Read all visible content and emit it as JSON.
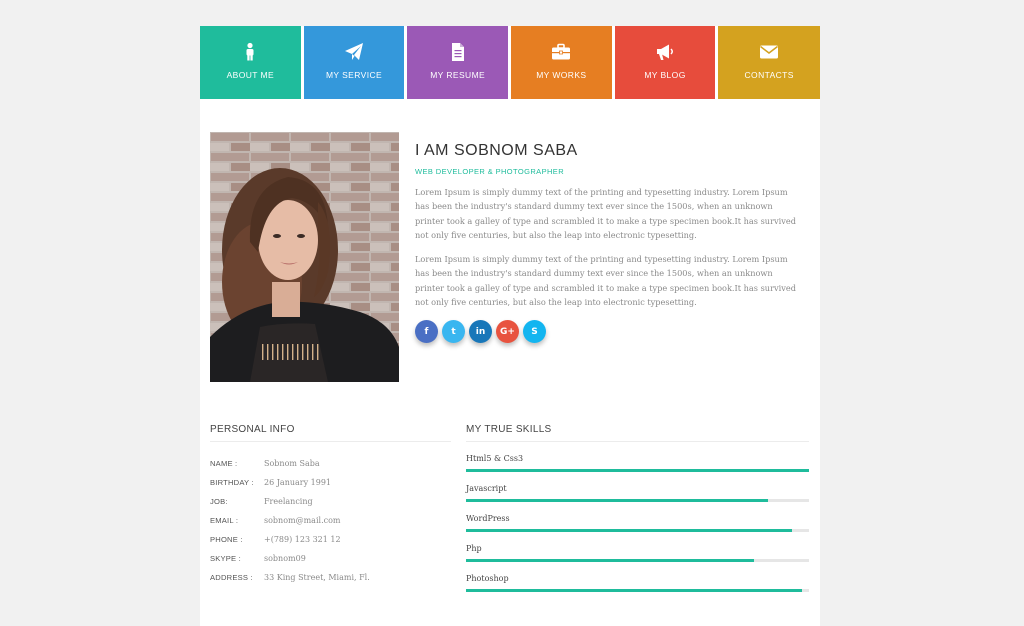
{
  "nav": [
    {
      "label": "ABOUT ME",
      "icon": "person-icon",
      "color": "#1fbc9c"
    },
    {
      "label": "MY SERVICE",
      "icon": "paper-plane-icon",
      "color": "#3498db"
    },
    {
      "label": "MY RESUME",
      "icon": "document-icon",
      "color": "#9b59b6"
    },
    {
      "label": "MY WORKS",
      "icon": "briefcase-icon",
      "color": "#e67e22"
    },
    {
      "label": "MY BLOG",
      "icon": "megaphone-icon",
      "color": "#e74c3c"
    },
    {
      "label": "CONTACTS",
      "icon": "envelope-icon",
      "color": "#d4a21f"
    }
  ],
  "profile": {
    "name": "I AM SOBNOM SABA",
    "role": "WEB DEVELOPER & PHOTOGRAPHER",
    "bio": [
      "Lorem Ipsum is simply dummy text of the printing and typesetting industry. Lorem Ipsum has been the industry's standard dummy text ever since the 1500s, when an unknown printer took a galley of type and scrambled it to make a type specimen book.It has survived not only five centuries, but also the leap into electronic typesetting.",
      "Lorem Ipsum is simply dummy text of the printing and typesetting industry. Lorem Ipsum has been the industry's standard dummy text ever since the 1500s, when an unknown printer took a galley of type and scrambled it to make a type specimen book.It has survived not only five centuries, but also the leap into electronic typesetting."
    ],
    "socials": [
      {
        "glyph": "f",
        "icon": "facebook-icon",
        "color": "#4a6fc4"
      },
      {
        "glyph": "t",
        "icon": "twitter-icon",
        "color": "#39b6f0"
      },
      {
        "glyph": "in",
        "icon": "linkedin-icon",
        "color": "#1877b9"
      },
      {
        "glyph": "G+",
        "icon": "google-plus-icon",
        "color": "#e8533f"
      },
      {
        "glyph": "S",
        "icon": "skype-icon",
        "color": "#13b5f0"
      }
    ]
  },
  "personal": {
    "title": "PERSONAL INFO",
    "rows": [
      {
        "label": "NAME :",
        "value": "Sobnom Saba"
      },
      {
        "label": "BIRTHDAY :",
        "value": "26 January 1991"
      },
      {
        "label": "JOB:",
        "value": "Freelancing"
      },
      {
        "label": "EMAIL :",
        "value": "sobnom@mail.com"
      },
      {
        "label": "PHONE :",
        "value": "+(789) 123 321 12"
      },
      {
        "label": "SKYPE :",
        "value": "sobnom09"
      },
      {
        "label": "ADDRESS :",
        "value": "33 King Street, Miami, Fl."
      }
    ]
  },
  "skills": {
    "title": "MY TRUE SKILLS",
    "items": [
      {
        "name": "Html5 & Css3",
        "level": 1.0
      },
      {
        "name": "Javascript",
        "level": 0.88
      },
      {
        "name": "WordPress",
        "level": 0.95
      },
      {
        "name": "Php",
        "level": 0.84
      },
      {
        "name": "Photoshop",
        "level": 0.98
      }
    ]
  },
  "colors": {
    "accent": "#1fbc9c"
  }
}
